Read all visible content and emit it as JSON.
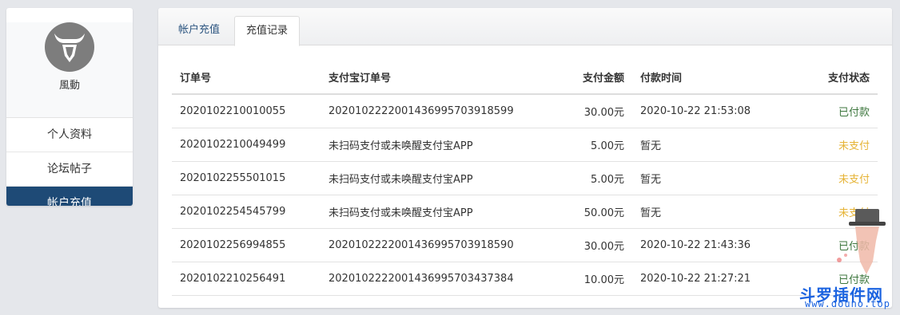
{
  "sidebar": {
    "username": "風動",
    "avatar_icon": "bull-head-icon",
    "items": [
      {
        "label": "个人资料"
      },
      {
        "label": "论坛帖子"
      },
      {
        "label": "帐户充值"
      }
    ],
    "active_color": "#1e4a76"
  },
  "tabs": [
    {
      "label": "帐户充值"
    },
    {
      "label": "充值记录"
    }
  ],
  "table": {
    "headers": [
      "订单号",
      "支付宝订单号",
      "支付金额",
      "付款时间",
      "支付状态"
    ],
    "rows": [
      {
        "order": "2020102210010055",
        "alipay": "2020102222001436995703918599",
        "amount": "30.00元",
        "time": "2020-10-22 21:53:08",
        "status": "已付款"
      },
      {
        "order": "2020102210049499",
        "alipay": "未扫码支付或未唤醒支付宝APP",
        "amount": "5.00元",
        "time": "暂无",
        "status": "未支付"
      },
      {
        "order": "2020102255501015",
        "alipay": "未扫码支付或未唤醒支付宝APP",
        "amount": "5.00元",
        "time": "暂无",
        "status": "未支付"
      },
      {
        "order": "2020102254545799",
        "alipay": "未扫码支付或未唤醒支付宝APP",
        "amount": "50.00元",
        "time": "暂无",
        "status": "未支付"
      },
      {
        "order": "2020102256994855",
        "alipay": "2020102222001436995703918590",
        "amount": "30.00元",
        "time": "2020-10-22 21:43:36",
        "status": "已付款"
      },
      {
        "order": "2020102210256491",
        "alipay": "2020102222001436995703437384",
        "amount": "10.00元",
        "time": "2020-10-22 21:27:21",
        "status": "已付款"
      }
    ],
    "colors": {
      "paid": "#3c763d",
      "unpaid": "#e6b437"
    }
  },
  "watermark": {
    "text": "斗罗插件网",
    "url": "www.douno.top"
  }
}
